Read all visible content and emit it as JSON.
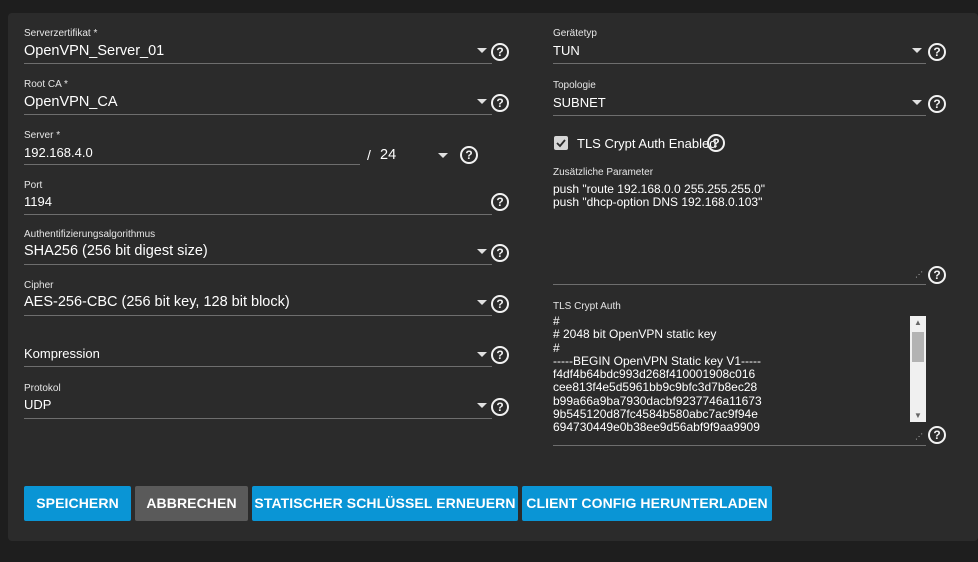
{
  "form": {
    "left": {
      "server_certificate": {
        "label": "Serverzertifikat *",
        "value": "OpenVPN_Server_01"
      },
      "root_ca": {
        "label": "Root CA *",
        "value": "OpenVPN_CA"
      },
      "server": {
        "label": "Server *",
        "value": "192.168.4.0",
        "separator": "/",
        "netmask": "24"
      },
      "port": {
        "label": "Port",
        "value": "1194"
      },
      "auth_algorithm": {
        "label": "Authentifizierungsalgorithmus",
        "value": "SHA256 (256 bit digest size)"
      },
      "cipher": {
        "label": "Cipher",
        "value": "AES-256-CBC (256 bit key, 128 bit block)"
      },
      "compression": {
        "label": "",
        "value": "Kompression"
      },
      "protocol": {
        "label": "Protokol",
        "value": "UDP"
      }
    },
    "right": {
      "device_type": {
        "label": "Gerätetyp",
        "value": "TUN"
      },
      "topology": {
        "label": "Topologie",
        "value": "SUBNET"
      },
      "tls_crypt_auth_enabled": {
        "label": "TLS Crypt Auth Enabled",
        "checked": true
      },
      "additional_params": {
        "label": "Zusätzliche Parameter",
        "lines": [
          "push \"route 192.168.0.0 255.255.255.0\"",
          "push \"dhcp-option DNS 192.168.0.103\""
        ]
      },
      "tls_crypt_auth": {
        "label": "TLS Crypt Auth",
        "lines": [
          "#",
          "# 2048 bit OpenVPN static key",
          "#",
          "-----BEGIN OpenVPN Static key V1-----",
          "f4df4b64bdc993d268f410001908c016",
          "cee813f4e5d5961bb9c9bfc3d7b8ec28",
          "b99a66a9ba7930dacbf9237746a11673",
          "9b545120d87fc4584b580abc7ac9f94e",
          "694730449e0b38ee9d56abf9f9aa9909"
        ]
      }
    },
    "help_glyph": "?"
  },
  "buttons": {
    "save": "SPEICHERN",
    "cancel": "ABBRECHEN",
    "renew_key": "STATISCHER SCHLÜSSEL ERNEUERN",
    "download_config": "CLIENT CONFIG HERUNTERLADEN"
  },
  "colors": {
    "background": "#1e1e1e",
    "card": "#2b2b2b",
    "primary_button": "#0a95d5",
    "secondary_button": "#5a5a5a"
  }
}
